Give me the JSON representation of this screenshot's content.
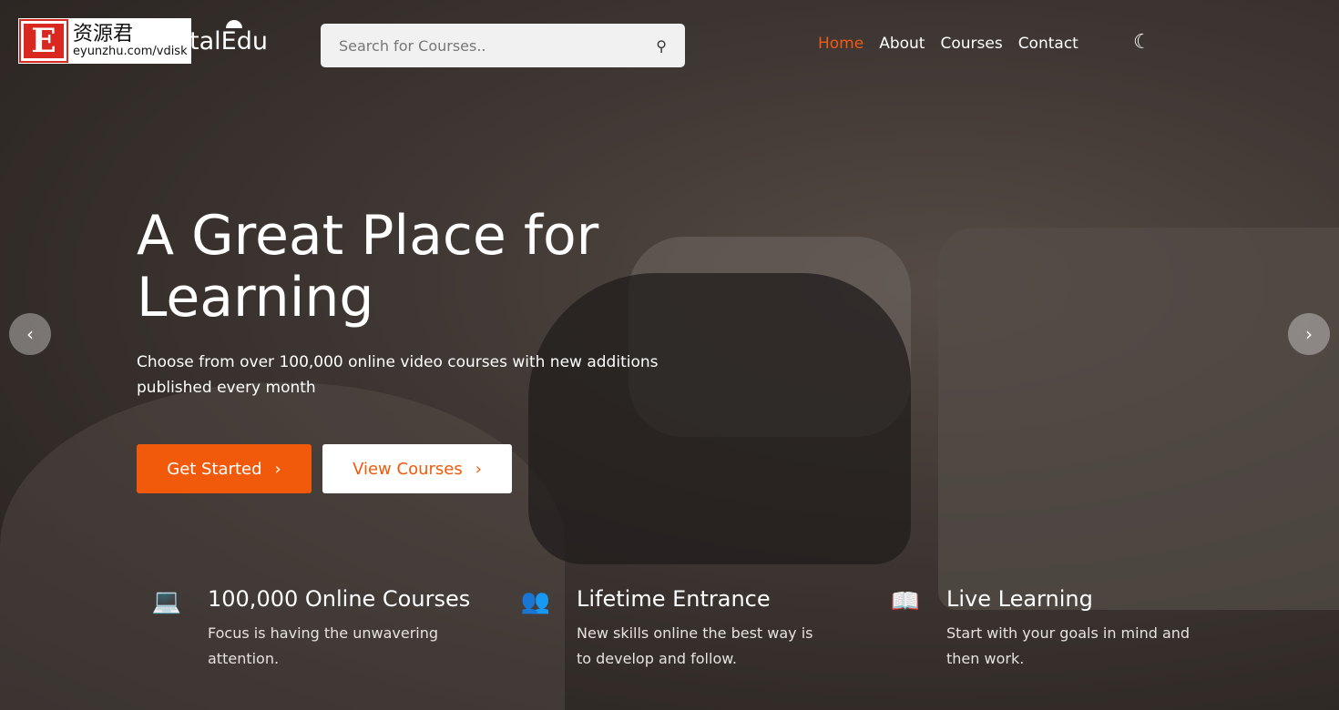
{
  "watermark": {
    "cn": "资源君",
    "url": "eyunzhu.com/vdisk",
    "letter": "E"
  },
  "header": {
    "logo": "talEdu",
    "search_placeholder": "Search for Courses..",
    "nav": [
      {
        "label": "Home",
        "active": true
      },
      {
        "label": "About"
      },
      {
        "label": "Courses"
      },
      {
        "label": "Contact"
      }
    ],
    "theme_icon": "moon-icon"
  },
  "hero": {
    "title": "A Great Place for Learning",
    "lead": "Choose from over 100,000 online video courses with new additions published every month",
    "primary": "Get Started",
    "secondary": "View Courses"
  },
  "features": [
    {
      "icon": "laptop-icon",
      "title": "100,000 Online Courses",
      "text": "Focus is having the unwavering attention."
    },
    {
      "icon": "users-icon",
      "title": "Lifetime Entrance",
      "text": "New skills online the best way is to develop and follow."
    },
    {
      "icon": "book-icon",
      "title": "Live Learning",
      "text": "Start with your goals in mind and then work."
    }
  ],
  "colors": {
    "accent": "#f15a0a"
  }
}
